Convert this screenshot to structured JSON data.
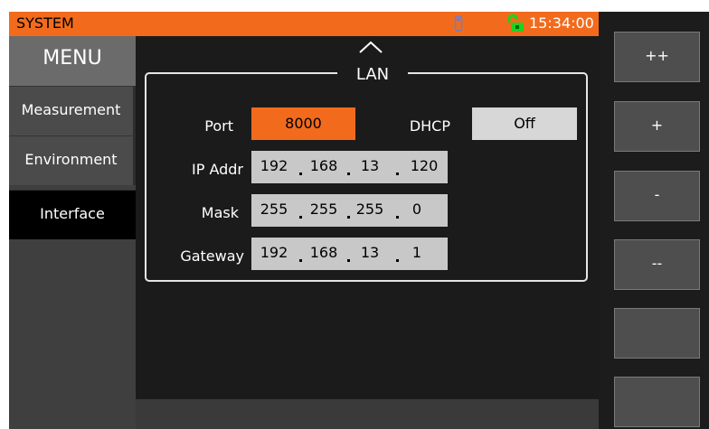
{
  "topbar": {
    "title": "SYSTEM",
    "time": "15:34:00",
    "usb_icon": "usb-icon",
    "lock_icon": "unlocked-icon",
    "accent": "#f26b1d"
  },
  "menu": {
    "header": "MENU",
    "items": [
      {
        "label": "Measurement",
        "active": false
      },
      {
        "label": "Environment",
        "active": false
      },
      {
        "label": "Interface",
        "active": true
      }
    ]
  },
  "lan": {
    "title": "LAN",
    "port_label": "Port",
    "port_value": "8000",
    "dhcp_label": "DHCP",
    "dhcp_value": "Off",
    "ip_label": "IP Addr",
    "ip": [
      "192",
      "168",
      "13",
      "120"
    ],
    "mask_label": "Mask",
    "mask": [
      "255",
      "255",
      "255",
      "0"
    ],
    "gateway_label": "Gateway",
    "gateway": [
      "192",
      "168",
      "13",
      "1"
    ]
  },
  "softkeys": [
    "++",
    "+",
    "-",
    "--",
    "",
    ""
  ]
}
